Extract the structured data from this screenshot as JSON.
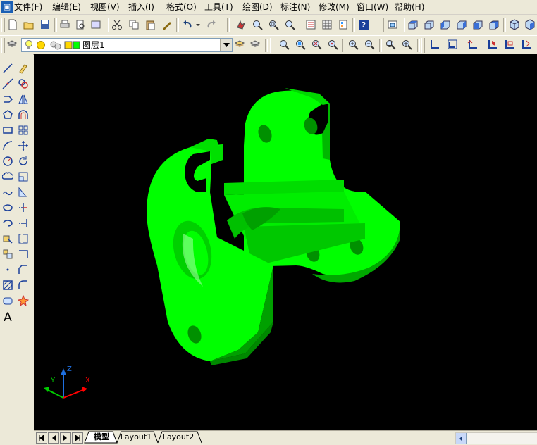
{
  "menu": {
    "app_icon": "autocad-app-icon",
    "items": [
      {
        "label": "文件(F)"
      },
      {
        "label": "编辑(E)"
      },
      {
        "label": "视图(V)"
      },
      {
        "label": "插入(I)"
      },
      {
        "label": "格式(O)"
      },
      {
        "label": "工具(T)"
      },
      {
        "label": "绘图(D)"
      },
      {
        "label": "标注(N)"
      },
      {
        "label": "修改(M)"
      },
      {
        "label": "窗口(W)"
      },
      {
        "label": "帮助(H)"
      }
    ]
  },
  "layer": {
    "current_name": "图层1",
    "icons": [
      "layer-on-bulb-icon",
      "sun-freeze-icon",
      "lock-icon",
      "layer-color-square-icon"
    ]
  },
  "tabs": {
    "model": "模型",
    "layout1": "Layout1",
    "layout2": "Layout2"
  },
  "ucs": {
    "x_label": "X",
    "y_label": "Y",
    "z_label": "Z"
  },
  "left_tools": {
    "text_tool": "A"
  },
  "colors": {
    "model_green": "#00ff00",
    "viewport_bg": "#000000",
    "ucs_x": "#ff0000",
    "ucs_y": "#00cc00",
    "ucs_z": "#1e6fe0"
  }
}
